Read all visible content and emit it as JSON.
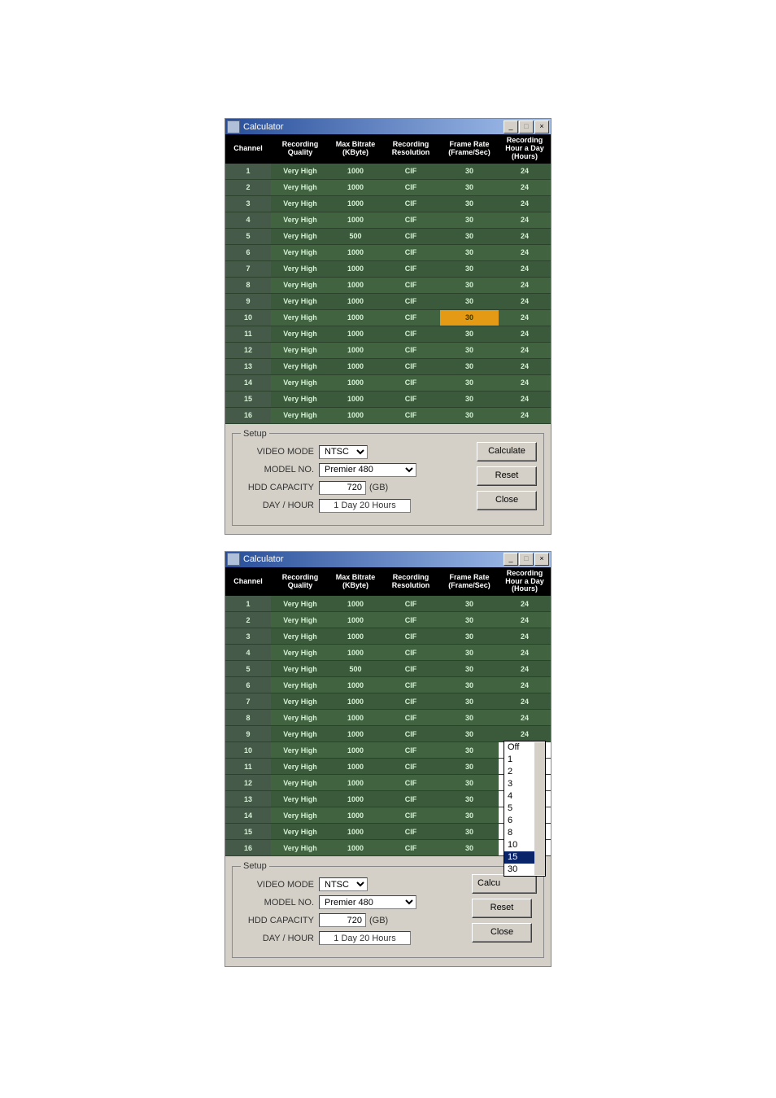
{
  "window_title": "Calculator",
  "table": {
    "headers": {
      "channel": "Channel",
      "quality": "Recording Quality",
      "bitrate": "Max Bitrate (KByte)",
      "resolution": "Recording Resolution",
      "framerate": "Frame Rate (Frame/Sec)",
      "hours": "Recording Hour a Day (Hours)"
    }
  },
  "win1": {
    "rows": [
      {
        "ch": "1",
        "quality": "Very High",
        "bitrate": "1000",
        "res": "CIF",
        "fps": "30",
        "hours": "24",
        "hl": false
      },
      {
        "ch": "2",
        "quality": "Very High",
        "bitrate": "1000",
        "res": "CIF",
        "fps": "30",
        "hours": "24",
        "hl": false
      },
      {
        "ch": "3",
        "quality": "Very High",
        "bitrate": "1000",
        "res": "CIF",
        "fps": "30",
        "hours": "24",
        "hl": false
      },
      {
        "ch": "4",
        "quality": "Very High",
        "bitrate": "1000",
        "res": "CIF",
        "fps": "30",
        "hours": "24",
        "hl": false
      },
      {
        "ch": "5",
        "quality": "Very High",
        "bitrate": "500",
        "res": "CIF",
        "fps": "30",
        "hours": "24",
        "hl": false
      },
      {
        "ch": "6",
        "quality": "Very High",
        "bitrate": "1000",
        "res": "CIF",
        "fps": "30",
        "hours": "24",
        "hl": false
      },
      {
        "ch": "7",
        "quality": "Very High",
        "bitrate": "1000",
        "res": "CIF",
        "fps": "30",
        "hours": "24",
        "hl": false
      },
      {
        "ch": "8",
        "quality": "Very High",
        "bitrate": "1000",
        "res": "CIF",
        "fps": "30",
        "hours": "24",
        "hl": false
      },
      {
        "ch": "9",
        "quality": "Very High",
        "bitrate": "1000",
        "res": "CIF",
        "fps": "30",
        "hours": "24",
        "hl": false
      },
      {
        "ch": "10",
        "quality": "Very High",
        "bitrate": "1000",
        "res": "CIF",
        "fps": "30",
        "hours": "24",
        "hl": true
      },
      {
        "ch": "11",
        "quality": "Very High",
        "bitrate": "1000",
        "res": "CIF",
        "fps": "30",
        "hours": "24",
        "hl": false
      },
      {
        "ch": "12",
        "quality": "Very High",
        "bitrate": "1000",
        "res": "CIF",
        "fps": "30",
        "hours": "24",
        "hl": false
      },
      {
        "ch": "13",
        "quality": "Very High",
        "bitrate": "1000",
        "res": "CIF",
        "fps": "30",
        "hours": "24",
        "hl": false
      },
      {
        "ch": "14",
        "quality": "Very High",
        "bitrate": "1000",
        "res": "CIF",
        "fps": "30",
        "hours": "24",
        "hl": false
      },
      {
        "ch": "15",
        "quality": "Very High",
        "bitrate": "1000",
        "res": "CIF",
        "fps": "30",
        "hours": "24",
        "hl": false
      },
      {
        "ch": "16",
        "quality": "Very High",
        "bitrate": "1000",
        "res": "CIF",
        "fps": "30",
        "hours": "24",
        "hl": false
      }
    ]
  },
  "win2": {
    "rows": [
      {
        "ch": "1",
        "quality": "Very High",
        "bitrate": "1000",
        "res": "CIF",
        "fps": "30",
        "hours": "24"
      },
      {
        "ch": "2",
        "quality": "Very High",
        "bitrate": "1000",
        "res": "CIF",
        "fps": "30",
        "hours": "24"
      },
      {
        "ch": "3",
        "quality": "Very High",
        "bitrate": "1000",
        "res": "CIF",
        "fps": "30",
        "hours": "24"
      },
      {
        "ch": "4",
        "quality": "Very High",
        "bitrate": "1000",
        "res": "CIF",
        "fps": "30",
        "hours": "24"
      },
      {
        "ch": "5",
        "quality": "Very High",
        "bitrate": "500",
        "res": "CIF",
        "fps": "30",
        "hours": "24"
      },
      {
        "ch": "6",
        "quality": "Very High",
        "bitrate": "1000",
        "res": "CIF",
        "fps": "30",
        "hours": "24"
      },
      {
        "ch": "7",
        "quality": "Very High",
        "bitrate": "1000",
        "res": "CIF",
        "fps": "30",
        "hours": "24"
      },
      {
        "ch": "8",
        "quality": "Very High",
        "bitrate": "1000",
        "res": "CIF",
        "fps": "30",
        "hours": "24"
      },
      {
        "ch": "9",
        "quality": "Very High",
        "bitrate": "1000",
        "res": "CIF",
        "fps": "30",
        "hours": "24"
      },
      {
        "ch": "10",
        "quality": "Very High",
        "bitrate": "1000",
        "res": "CIF",
        "fps": "30",
        "hours": "Off"
      },
      {
        "ch": "11",
        "quality": "Very High",
        "bitrate": "1000",
        "res": "CIF",
        "fps": "30",
        "hours": "1"
      },
      {
        "ch": "12",
        "quality": "Very High",
        "bitrate": "1000",
        "res": "CIF",
        "fps": "30",
        "hours": "2"
      },
      {
        "ch": "13",
        "quality": "Very High",
        "bitrate": "1000",
        "res": "CIF",
        "fps": "30",
        "hours": "3"
      },
      {
        "ch": "14",
        "quality": "Very High",
        "bitrate": "1000",
        "res": "CIF",
        "fps": "30",
        "hours": "4"
      },
      {
        "ch": "15",
        "quality": "Very High",
        "bitrate": "1000",
        "res": "CIF",
        "fps": "30",
        "hours": "5"
      },
      {
        "ch": "16",
        "quality": "Very High",
        "bitrate": "1000",
        "res": "CIF",
        "fps": "30",
        "hours": "6"
      }
    ],
    "dropdown": {
      "options": [
        "Off",
        "1",
        "2",
        "3",
        "4",
        "5",
        "6",
        "8",
        "10",
        "15",
        "30"
      ],
      "selected": "15"
    }
  },
  "setup": {
    "legend": "Setup",
    "video_mode_label": "VIDEO MODE",
    "video_mode_value": "NTSC",
    "model_label": "MODEL NO.",
    "model_value": "Premier 480",
    "hdd_label": "HDD CAPACITY",
    "hdd_value": "720",
    "hdd_unit": "(GB)",
    "dayhour_label": "DAY / HOUR",
    "dayhour_value": "1 Day 20 Hours"
  },
  "buttons": {
    "calculate": "Calculate",
    "calculate_short": "Calcu",
    "reset": "Reset",
    "close": "Close"
  }
}
